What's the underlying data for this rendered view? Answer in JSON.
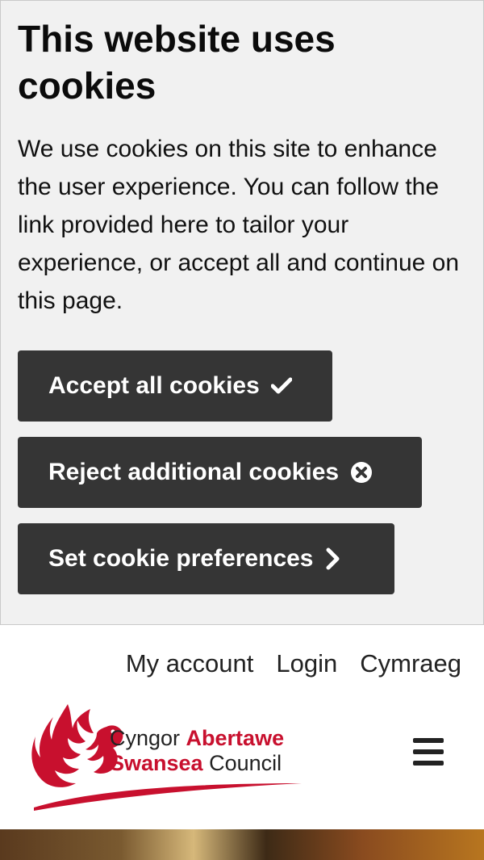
{
  "cookie_banner": {
    "title": "This website uses cookies",
    "text": "We use cookies on this site to enhance the user experience. You can follow the link provided here to tailor your experience, or accept all and continue on this page.",
    "accept_label": "Accept all cookies",
    "reject_label": "Reject additional cookies",
    "preferences_label": "Set cookie preferences",
    "button_color": "#353535",
    "background_color": "#f1f1f1"
  },
  "header": {
    "links": {
      "account": "My account",
      "login": "Login",
      "language": "Cymraeg"
    },
    "logo": {
      "line1_plain": "Cyngor ",
      "line1_bold": "Abertawe",
      "line2_bold": "Swansea",
      "line2_plain": " Council",
      "brand_color": "#c8102e"
    },
    "menu_icon": "hamburger-menu-icon"
  },
  "icons": {
    "accept": "checkmark-icon",
    "reject": "circle-x-icon",
    "preferences": "chevron-right-icon"
  }
}
